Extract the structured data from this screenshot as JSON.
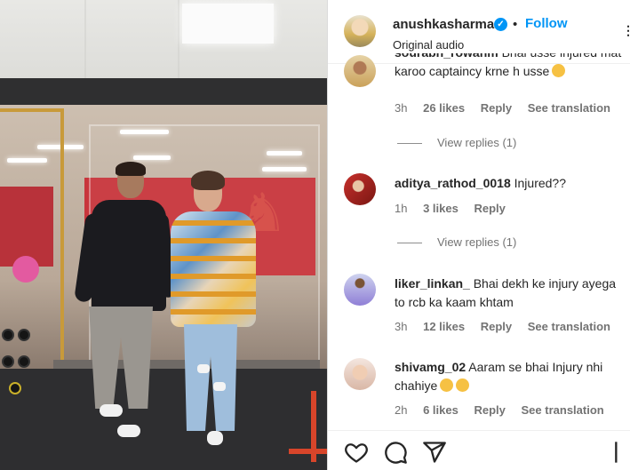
{
  "post": {
    "username": "anushkasharma",
    "verified_icon": "verified-badge-icon",
    "separator": "•",
    "follow_label": "Follow",
    "audio_label": "Original audio",
    "more_icon": "more-options-icon"
  },
  "comments": [
    {
      "username": "sourabh_rowanm",
      "text": "Bhai usse injured mat karoo captaincy krne h usse",
      "emoji": "pleading-face-emoji",
      "time": "3h",
      "likes": "26 likes",
      "reply_label": "Reply",
      "translation_label": "See translation",
      "view_replies": "View replies (1)"
    },
    {
      "username": "aditya_rathod_0018",
      "text": "Injured??",
      "time": "1h",
      "likes": "3 likes",
      "reply_label": "Reply",
      "view_replies": "View replies (1)"
    },
    {
      "username": "liker_linkan_",
      "text": "Bhai dekh ke injury ayega to rcb ka kaam khtam",
      "time": "3h",
      "likes": "12 likes",
      "reply_label": "Reply",
      "translation_label": "See translation"
    },
    {
      "username": "shivamg_02",
      "text": "Aaram se bhai Injury nhi chahiye",
      "emoji": "salute-emoji",
      "time": "2h",
      "likes": "6 likes",
      "reply_label": "Reply",
      "translation_label": "See translation"
    }
  ],
  "actions": {
    "like_icon": "heart-icon",
    "comment_icon": "comment-icon",
    "share_icon": "share-icon",
    "save_icon": "bookmark-icon"
  },
  "colors": {
    "accent": "#0095f6",
    "text_primary": "#262626",
    "text_secondary": "#737373",
    "border": "#dbdbdb"
  }
}
